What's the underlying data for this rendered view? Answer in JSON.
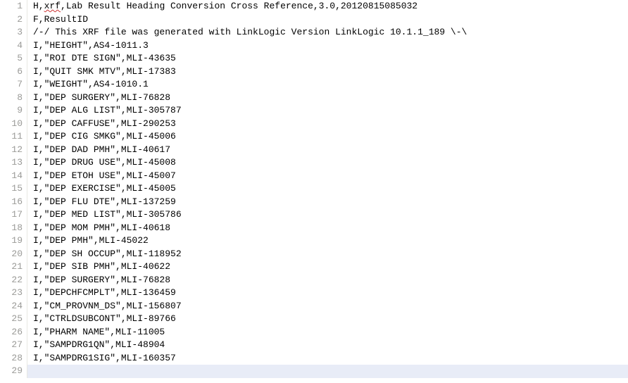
{
  "lines": [
    {
      "num": 1,
      "parts": [
        {
          "t": "H,"
        },
        {
          "t": "xrf",
          "squiggle": true
        },
        {
          "t": ",Lab Result Heading Conversion Cross Reference,3.0,20120815085032"
        }
      ]
    },
    {
      "num": 2,
      "parts": [
        {
          "t": "F,ResultID"
        }
      ]
    },
    {
      "num": 3,
      "parts": [
        {
          "t": "/-/ This XRF file was generated with LinkLogic Version LinkLogic 10.1.1_189 \\-\\"
        }
      ]
    },
    {
      "num": 4,
      "parts": [
        {
          "t": "I,\"HEIGHT\",AS4-1011.3"
        }
      ]
    },
    {
      "num": 5,
      "parts": [
        {
          "t": "I,\"ROI DTE SIGN\",MLI-43635"
        }
      ]
    },
    {
      "num": 6,
      "parts": [
        {
          "t": "I,\"QUIT SMK MTV\",MLI-17383"
        }
      ]
    },
    {
      "num": 7,
      "parts": [
        {
          "t": "I,\"WEIGHT\",AS4-1010.1"
        }
      ]
    },
    {
      "num": 8,
      "parts": [
        {
          "t": "I,\"DEP SURGERY\",MLI-76828"
        }
      ]
    },
    {
      "num": 9,
      "parts": [
        {
          "t": "I,\"DEP ALG LIST\",MLI-305787"
        }
      ]
    },
    {
      "num": 10,
      "parts": [
        {
          "t": "I,\"DEP CAFFUSE\",MLI-290253"
        }
      ]
    },
    {
      "num": 11,
      "parts": [
        {
          "t": "I,\"DEP CIG SMKG\",MLI-45006"
        }
      ]
    },
    {
      "num": 12,
      "parts": [
        {
          "t": "I,\"DEP DAD PMH\",MLI-40617"
        }
      ]
    },
    {
      "num": 13,
      "parts": [
        {
          "t": "I,\"DEP DRUG USE\",MLI-45008"
        }
      ]
    },
    {
      "num": 14,
      "parts": [
        {
          "t": "I,\"DEP ETOH USE\",MLI-45007"
        }
      ]
    },
    {
      "num": 15,
      "parts": [
        {
          "t": "I,\"DEP EXERCISE\",MLI-45005"
        }
      ]
    },
    {
      "num": 16,
      "parts": [
        {
          "t": "I,\"DEP FLU DTE\",MLI-137259"
        }
      ]
    },
    {
      "num": 17,
      "parts": [
        {
          "t": "I,\"DEP MED LIST\",MLI-305786"
        }
      ]
    },
    {
      "num": 18,
      "parts": [
        {
          "t": "I,\"DEP MOM PMH\",MLI-40618"
        }
      ]
    },
    {
      "num": 19,
      "parts": [
        {
          "t": "I,\"DEP PMH\",MLI-45022"
        }
      ]
    },
    {
      "num": 20,
      "parts": [
        {
          "t": "I,\"DEP SH OCCUP\",MLI-118952"
        }
      ]
    },
    {
      "num": 21,
      "parts": [
        {
          "t": "I,\"DEP SIB PMH\",MLI-40622"
        }
      ]
    },
    {
      "num": 22,
      "parts": [
        {
          "t": "I,\"DEP SURGERY\",MLI-76828"
        }
      ]
    },
    {
      "num": 23,
      "parts": [
        {
          "t": "I,\"DEPCHFCMPLT\",MLI-136459"
        }
      ]
    },
    {
      "num": 24,
      "parts": [
        {
          "t": "I,\"CM_PROVNM_DS\",MLI-156807"
        }
      ]
    },
    {
      "num": 25,
      "parts": [
        {
          "t": "I,\"CTRLDSUBCONT\",MLI-89766"
        }
      ]
    },
    {
      "num": 26,
      "parts": [
        {
          "t": "I,\"PHARM NAME\",MLI-11005"
        }
      ]
    },
    {
      "num": 27,
      "parts": [
        {
          "t": "I,\"SAMPDRG1QN\",MLI-48904"
        }
      ]
    },
    {
      "num": 28,
      "parts": [
        {
          "t": "I,\"SAMPDRG1SIG\",MLI-160357"
        }
      ]
    },
    {
      "num": 29,
      "parts": [
        {
          "t": ""
        }
      ],
      "current": true
    }
  ]
}
